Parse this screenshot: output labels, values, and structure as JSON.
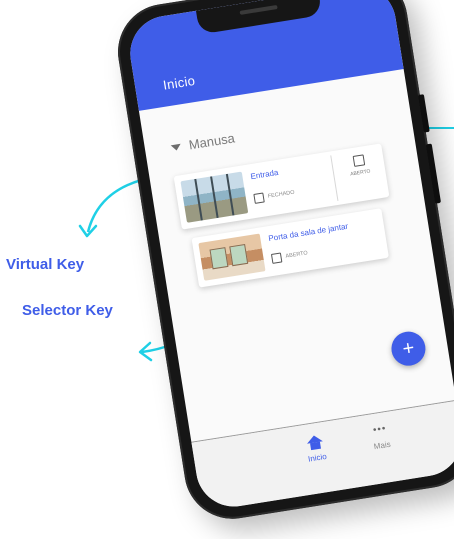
{
  "app": {
    "header_title": "Inicio",
    "section_label": "Manusa",
    "accent_color": "#3f5de8"
  },
  "cards": [
    {
      "title": "Entrada",
      "lock_state_label": "FECHADO",
      "toggle_label": "ABERTO",
      "image": "glass-door-entrance"
    },
    {
      "title": "Porta da sala de jantar",
      "lock_state_label": "ABERTO",
      "image": "dining-room-door"
    }
  ],
  "fab": {
    "icon": "plus-icon",
    "label": "+"
  },
  "bottom_nav": [
    {
      "label": "Inicio",
      "icon": "home-icon",
      "active": true
    },
    {
      "label": "Mais",
      "icon": "more-dots-icon",
      "active": false,
      "glyph": "•••"
    }
  ],
  "annotations": {
    "virtual_key": "Virtual Key",
    "selector_key": "Selector Key",
    "arrow_color": "#1fd0e6"
  }
}
